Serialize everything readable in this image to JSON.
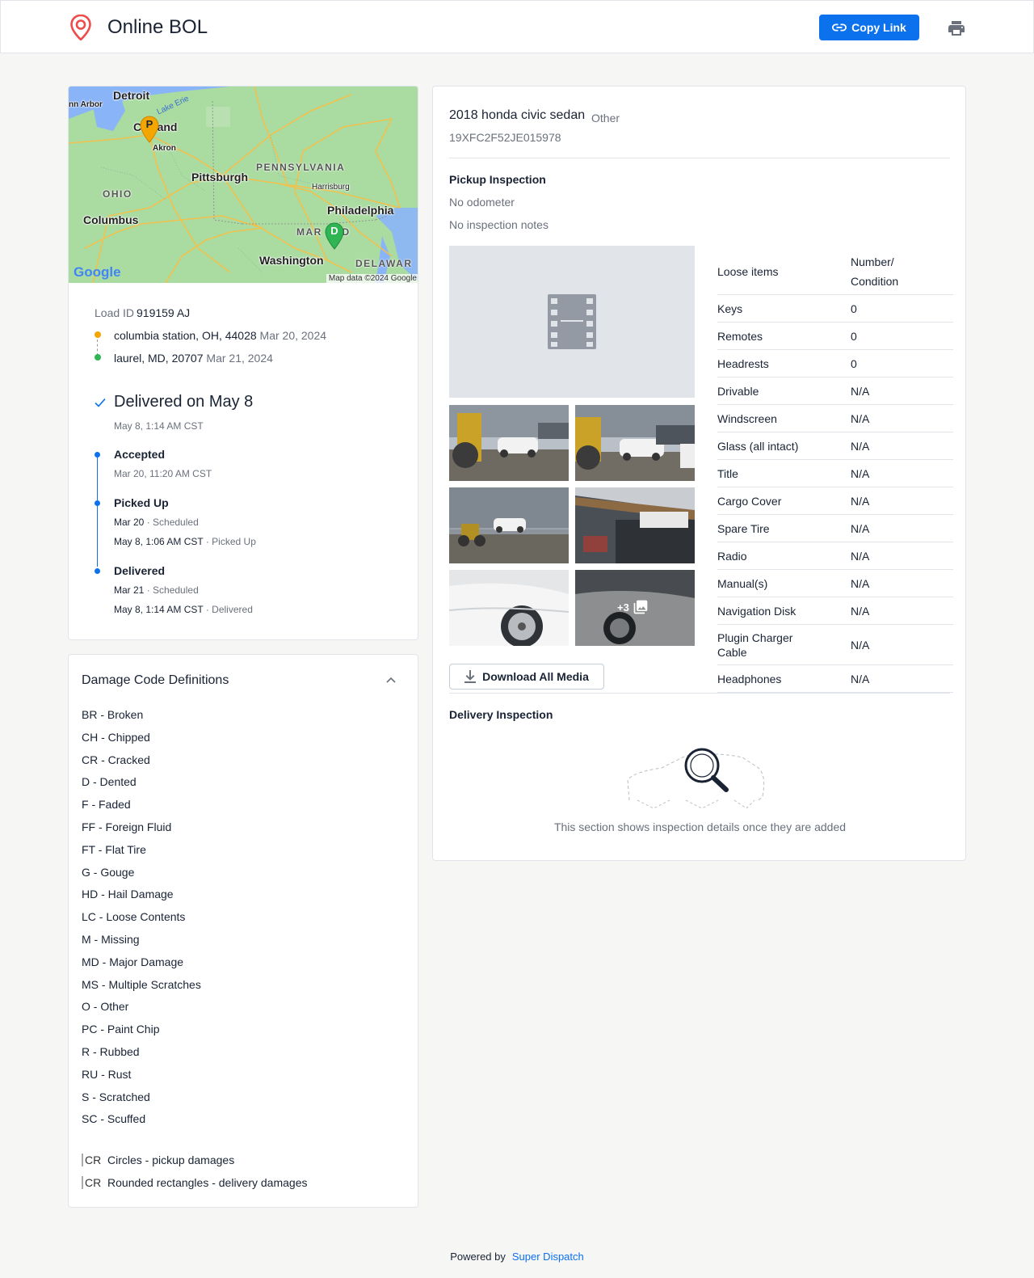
{
  "header": {
    "title": "Online BOL",
    "copy_link_label": "Copy Link"
  },
  "map": {
    "cities": {
      "detroit": "Detroit",
      "ann_arbor": "nn Arbor",
      "cleveland": "Cl  eland",
      "akron": "Akron",
      "pittsburgh": "Pittsburgh",
      "ohio": "OHIO",
      "columbus": "Columbus",
      "pennsylvania": "PENNSYLVANIA",
      "harrisburg": "Harrisburg",
      "philadelphia": "Philadelphia",
      "maryland": "MAR    AND",
      "washington": "Washington",
      "delaware": "DELAWAR",
      "lake_erie": "Lake Erie"
    },
    "pickup_marker": "P",
    "delivery_marker": "D",
    "google": "Google",
    "credit": "Map data ©2024 Google"
  },
  "load": {
    "id_label": "Load ID",
    "id_value": "919159 AJ",
    "pickup_address": "columbia station, OH, 44028",
    "pickup_date": "Mar 20, 2024",
    "delivery_address": "laurel, MD, 20707",
    "delivery_date": "Mar 21, 2024",
    "status_title": "Delivered on May 8",
    "status_time": "May 8, 1:14 AM CST",
    "timeline": [
      {
        "title": "Accepted",
        "line1": "Mar 20, 11:20 AM CST"
      },
      {
        "title": "Picked Up",
        "line1_date": "Mar 20",
        "line1_note": "· Scheduled",
        "line2_date": "May 8, 1:06 AM CST",
        "line2_note": "· Picked Up"
      },
      {
        "title": "Delivered",
        "line1_date": "Mar 21",
        "line1_note": "· Scheduled",
        "line2_date": "May 8, 1:14 AM CST",
        "line2_note": "· Delivered"
      }
    ]
  },
  "damage_codes": {
    "title": "Damage Code Definitions",
    "items": [
      "BR - Broken",
      "CH - Chipped",
      "CR - Cracked",
      "D - Dented",
      "F - Faded",
      "FF - Foreign Fluid",
      "FT - Flat Tire",
      "G - Gouge",
      "HD - Hail Damage",
      "LC - Loose Contents",
      "M - Missing",
      "MD - Major Damage",
      "MS - Multiple Scratches",
      "O - Other",
      "PC - Paint Chip",
      "R - Rubbed",
      "RU - Rust",
      "S - Scratched",
      "SC - Scuffed"
    ],
    "legend": [
      {
        "alt": "CR",
        "text": "Circles - pickup damages"
      },
      {
        "alt": "CR",
        "text": "Rounded rectangles - delivery damages"
      }
    ]
  },
  "vehicle": {
    "name": "2018 honda civic sedan",
    "type": "Other",
    "vin": "19XFC2F52JE015978"
  },
  "pickup_inspection": {
    "title": "Pickup Inspection",
    "odometer": "No odometer",
    "notes": "No inspection notes",
    "more_photos": "+3",
    "download_label": "Download All Media",
    "table_header": {
      "item": "Loose items",
      "value_line1": "Number/",
      "value_line2": "Condition"
    },
    "rows": [
      {
        "item": "Keys",
        "value": "0"
      },
      {
        "item": "Remotes",
        "value": "0"
      },
      {
        "item": "Headrests",
        "value": "0"
      },
      {
        "item": "Drivable",
        "value": "N/A"
      },
      {
        "item": "Windscreen",
        "value": "N/A"
      },
      {
        "item": "Glass (all intact)",
        "value": "N/A"
      },
      {
        "item": "Title",
        "value": "N/A"
      },
      {
        "item": "Cargo Cover",
        "value": "N/A"
      },
      {
        "item": "Spare Tire",
        "value": "N/A"
      },
      {
        "item": "Radio",
        "value": "N/A"
      },
      {
        "item": "Manual(s)",
        "value": "N/A"
      },
      {
        "item": "Navigation Disk",
        "value": "N/A"
      },
      {
        "item": "Plugin Charger Cable",
        "value": "N/A"
      },
      {
        "item": "Headphones",
        "value": "N/A"
      }
    ]
  },
  "delivery_inspection": {
    "title": "Delivery Inspection",
    "empty_text": "This section shows inspection details once they are added"
  },
  "footer": {
    "powered_by": "Powered by",
    "brand": "Super Dispatch"
  },
  "colors": {
    "accent": "#0c71ed",
    "pickup": "#f4a600",
    "delivery": "#2fb553"
  }
}
